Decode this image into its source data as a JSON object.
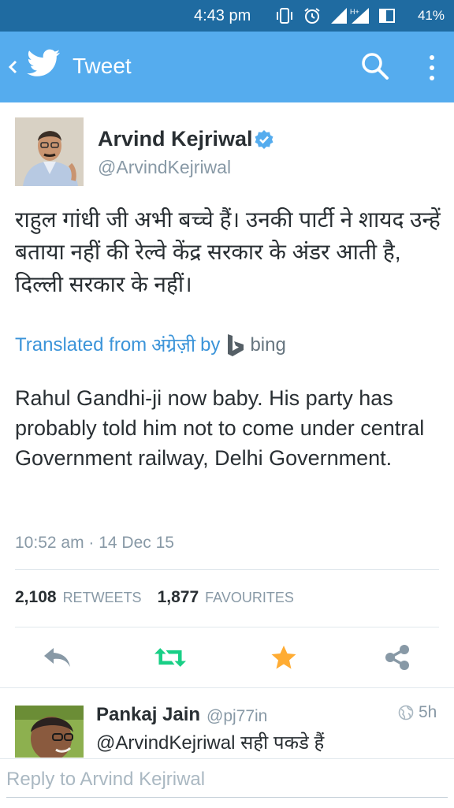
{
  "status_bar": {
    "time": "4:43 pm",
    "network": "H+",
    "battery": "41%",
    "icons": [
      "vibrate-icon",
      "alarm-icon",
      "signal-icon",
      "battery-icon"
    ]
  },
  "app_bar": {
    "title": "Tweet",
    "background": "#55acee",
    "icons": [
      "back-icon",
      "twitter-bird-icon",
      "search-icon",
      "overflow-menu-icon"
    ]
  },
  "tweet": {
    "author_name": "Arvind Kejriwal",
    "verified": true,
    "author_handle": "@ArvindKejriwal",
    "text_hindi": "राहुल गांधी जी अभी बच्चे हैं। उनकी पार्टी ने शायद उन्हें बताया नहीं की रेल्वे केंद्र सरकार के अंडर आती है, दिल्ली सरकार के नहीं।",
    "translated_prefix": "Translated from",
    "translated_language": "अंग्रेज़ी",
    "translated_by": "by",
    "translator": "bing",
    "text_english": "Rahul Gandhi-ji now baby. His party has probably told him not to come under central Government railway, Delhi Government.",
    "timestamp": "10:52 am · 14 Dec 15",
    "retweets_count": "2,108",
    "retweets_label": "RETWEETS",
    "favourites_count": "1,877",
    "favourites_label": "FAVOURITES"
  },
  "actions": {
    "icons": [
      "reply-icon",
      "retweet-icon",
      "favourite-star-icon",
      "share-icon"
    ],
    "colors": {
      "reply": "#8899a6",
      "retweet": "#19cf86",
      "favourite": "#ffac33",
      "share": "#8899a6"
    }
  },
  "reply": {
    "author_name": "Pankaj Jain",
    "author_handle": "@pj77in",
    "time": "5h",
    "text": "@ArvindKejriwal सही पकडे हैं"
  },
  "reply_box": {
    "placeholder": "Reply to Arvind Kejriwal"
  }
}
